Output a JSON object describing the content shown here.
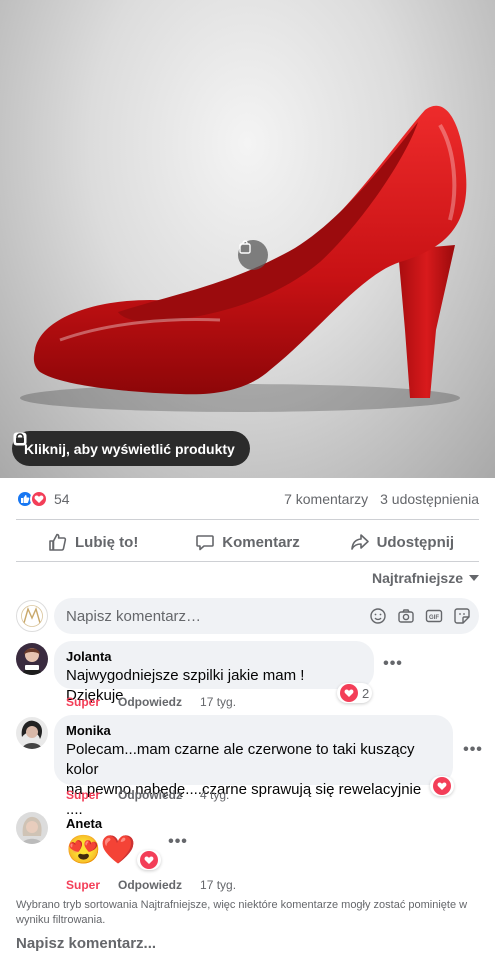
{
  "photo": {
    "view_products_label": "Kliknij, aby wyświetlić produkty",
    "icons": {
      "tag": "shopping-bag-icon"
    }
  },
  "stats": {
    "reaction_count": "54",
    "comments": "7 komentarzy",
    "shares": "3 udostępnienia"
  },
  "actions": {
    "like": "Lubię to!",
    "comment": "Komentarz",
    "share": "Udostępnij"
  },
  "sort": {
    "label": "Najtrafniejsze"
  },
  "composer": {
    "placeholder": "Napisz komentarz…"
  },
  "comments": [
    {
      "author": "Jolanta",
      "text": "Najwygodniejsze szpilki jakie mam ! Dziękuje",
      "reaction_label": "Super",
      "reply": "Odpowiedz",
      "time": "17 tyg.",
      "reaction_count": "2"
    },
    {
      "author": "Monika",
      "text_line1": "Polecam...mam czarne ale czerwone to taki kuszący kolor",
      "text_line2": "na pewno nabędę....czarne sprawują się rewelacyjnie ....",
      "reaction_label": "Super",
      "reply": "Odpowiedz",
      "time": "4 tyg."
    },
    {
      "author": "Aneta",
      "text": "😍❤️",
      "reaction_label": "Super",
      "reply": "Odpowiedz",
      "time": "17 tyg."
    }
  ],
  "footer": {
    "note": "Wybrano tryb sortowania Najtrafniejsze, więc niektóre komentarze mogły zostać pominięte w wyniku filtrowania.",
    "compose": "Napisz komentarz..."
  },
  "colors": {
    "love": "#f33e58",
    "like": "#1877f2",
    "shoe": "#d7151a"
  }
}
